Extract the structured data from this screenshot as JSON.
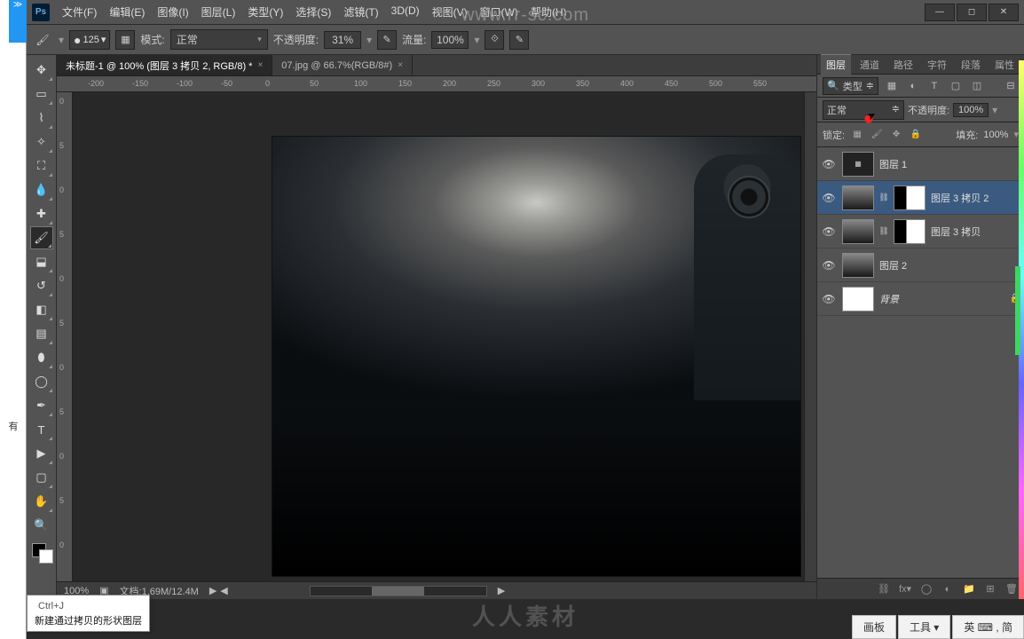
{
  "watermark_top": "www.rr-sc.com",
  "watermark_bottom": "人人素材",
  "left_strip_text": "有",
  "menubar": {
    "file": "文件(F)",
    "edit": "编辑(E)",
    "image": "图像(I)",
    "layer": "图层(L)",
    "type": "类型(Y)",
    "select": "选择(S)",
    "filter": "滤镜(T)",
    "threeD": "3D(D)",
    "view": "视图(V)",
    "window": "窗口(W)",
    "help": "帮助(H)"
  },
  "options": {
    "brush_size": "125",
    "mode_label": "模式:",
    "mode_value": "正常",
    "opacity_label": "不透明度:",
    "opacity_value": "31%",
    "flow_label": "流量:",
    "flow_value": "100%"
  },
  "tabs": {
    "tab1": "未标题-1 @ 100% (图层 3 拷贝 2, RGB/8) *",
    "tab2": "07.jpg @ 66.7%(RGB/8#)"
  },
  "ruler_h": [
    "-200",
    "-150",
    "-100",
    "-50",
    "0",
    "50",
    "100",
    "150",
    "200",
    "250",
    "300",
    "350",
    "400",
    "450",
    "500",
    "550"
  ],
  "ruler_v": [
    "0",
    "5",
    "0",
    "5",
    "0",
    "5",
    "0",
    "5",
    "0",
    "5",
    "0"
  ],
  "status": {
    "zoom": "100%",
    "doc": "文档:1.69M/12.4M"
  },
  "panels": {
    "tabs": {
      "layers": "图层",
      "channels": "通道",
      "paths": "路径",
      "char": "字符",
      "para": "段落",
      "attr": "属性"
    },
    "filter_kind": "类型",
    "blend_mode": "正常",
    "opacity_label": "不透明度:",
    "opacity_value": "100%",
    "lock_label": "锁定:",
    "fill_label": "填充:",
    "fill_value": "100%",
    "layers": {
      "l1": "图层 1",
      "l2": "图层 3 拷贝 2",
      "l3": "图层 3 拷贝",
      "l4": "图层 2",
      "l5": "背景"
    }
  },
  "tooltip": {
    "shortcut": "Ctrl+J",
    "text": "新建通过拷贝的形状图层"
  },
  "taskbar": {
    "b1": "画板",
    "b2": "工具 ▾",
    "b3": "英 ⌨ , 简"
  }
}
